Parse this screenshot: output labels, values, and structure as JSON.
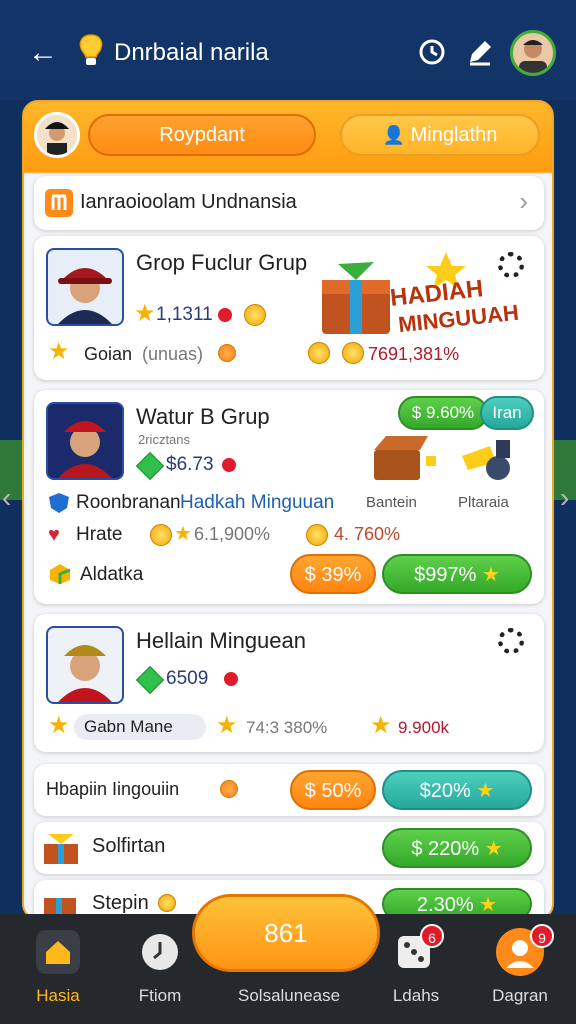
{
  "top_bar": {
    "title": "Dnrbaial narila"
  },
  "panel_header": {
    "button_left": "Roypdant",
    "button_right": "Minglathn"
  },
  "header_bar": {
    "label": "Ianraoioolam Undnansia"
  },
  "card1": {
    "title": "Grop Fuclur Grup",
    "stat": "1,1311",
    "label": "Goian",
    "sub": "(unuas)",
    "value": "7691,381%",
    "promo": {
      "line1": "HADIAH",
      "line2": "MINGUUAH"
    }
  },
  "card2": {
    "title": "Watur B Grup",
    "subtitle": "2ricztans",
    "stat": "$6.73",
    "pill_green": "$ 9.60%",
    "pill_teal": "Iran",
    "desc": "Roonbranan",
    "desc_link": "Hadkah Minguuan",
    "icon_label1": "Bantein",
    "icon_label2": "Pltaraia",
    "row_label": "Hrate",
    "row_val1": "6.1,900%",
    "row_val2": "4. 760%",
    "bottom_label": "Aldatka",
    "pill_orange": "$ 39%",
    "pill_green2": "$997%"
  },
  "card3": {
    "title": "Hellain Minguean",
    "stat": "6509",
    "tag": "Gabn Mane",
    "val1": "74:3 380%",
    "val2": "9.900k"
  },
  "row4": {
    "label": "Hbapiin Iingouiin",
    "pill1": "$ 50%",
    "pill2": "$20%"
  },
  "row5": {
    "label": "Solfirtan",
    "pill": "$ 220%"
  },
  "row6": {
    "label": "Stepin",
    "pill": "2.30%"
  },
  "nav": {
    "center": "861",
    "items": [
      {
        "label": "Hasia"
      },
      {
        "label": "Ftiom"
      },
      {
        "label": "Solsalunease"
      },
      {
        "label": "Ldahs",
        "badge": "6"
      },
      {
        "label": "Dagran",
        "badge": "9"
      }
    ]
  },
  "colors": {
    "accent": "#ff9c12",
    "nav_bg": "#25282d",
    "top_bg": "#13356a"
  }
}
